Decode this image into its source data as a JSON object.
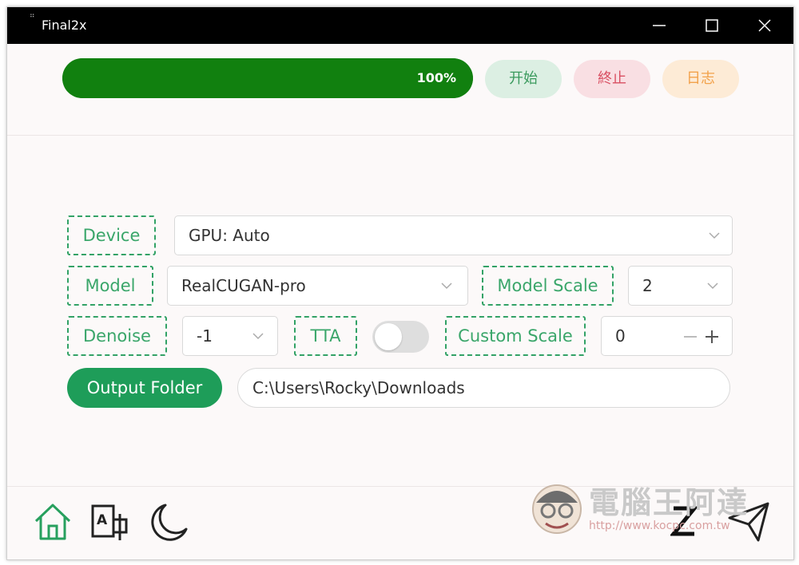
{
  "titlebar": {
    "title": "Final2x"
  },
  "progress": {
    "value": 100,
    "label": "100%"
  },
  "actions": {
    "start": "开始",
    "stop": "終止",
    "log": "日志"
  },
  "settings": {
    "device_label": "Device",
    "device_value": "GPU: Auto",
    "model_label": "Model",
    "model_value": "RealCUGAN-pro",
    "model_scale_label": "Model Scale",
    "model_scale_value": "2",
    "denoise_label": "Denoise",
    "denoise_value": "-1",
    "tta_label": "TTA",
    "tta_enabled": false,
    "custom_scale_label": "Custom Scale",
    "custom_scale_value": "0"
  },
  "output": {
    "button": "Output Folder",
    "path": "C:\\Users\\Rocky\\Downloads"
  },
  "watermark": {
    "title": "電腦王阿達",
    "url": "http://www.kocpc.com.tw"
  },
  "colors": {
    "accent": "#1e9d59",
    "progress": "#117d11",
    "start": "#dcefe3",
    "stop": "#f9dfe3",
    "log": "#fdebd6"
  }
}
